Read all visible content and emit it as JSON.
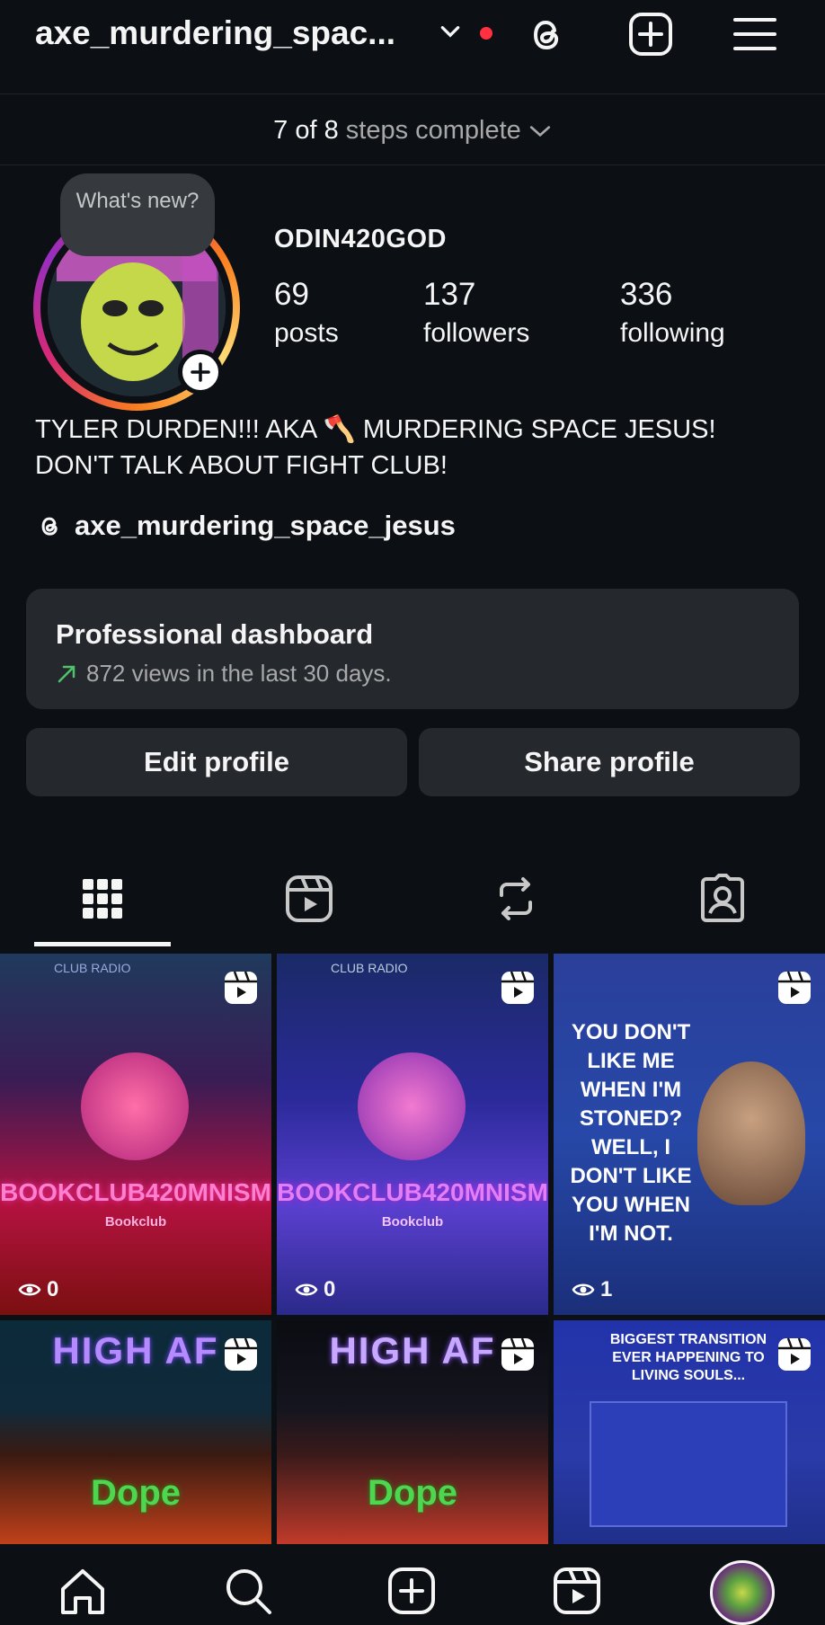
{
  "header": {
    "username": "axe_murdering_spac...",
    "icons": [
      "chevron-down-icon",
      "threads-icon",
      "create-icon",
      "menu-icon"
    ],
    "notification_dot_color": "#ff3040"
  },
  "steps": {
    "done": "7",
    "of": "of",
    "total": "8",
    "text": "steps complete"
  },
  "profile": {
    "bubble_text": "What's new?",
    "display_name": "ODIN420GOD",
    "stats": [
      {
        "number": "69",
        "label": "posts"
      },
      {
        "number": "137",
        "label": "followers"
      },
      {
        "number": "336",
        "label": "following"
      }
    ],
    "bio_line1": "TYLER DURDEN!!! AKA 🪓 MURDERING SPACE JESUS!",
    "bio_line2": "DON'T TALK ABOUT FIGHT CLUB!",
    "threads_handle": "axe_murdering_space_jesus"
  },
  "dashboard": {
    "title": "Professional dashboard",
    "subtitle": "872 views in the last 30 days.",
    "trend_color": "#4fc36b"
  },
  "buttons": {
    "edit": "Edit profile",
    "share": "Share profile"
  },
  "tabs": [
    "grid-icon",
    "reels-icon",
    "reposts-icon",
    "tagged-icon"
  ],
  "grid": [
    {
      "caption": "BOOKCLUB420MNISM",
      "sub": "Bookclub",
      "views": "0",
      "top_text": "CLUB RADIO"
    },
    {
      "caption": "BOOKCLUB420MNISM",
      "sub": "Bookclub",
      "views": "0",
      "top_text": "CLUB RADIO"
    },
    {
      "caption": "YOU DON'T LIKE ME WHEN I'M STONED? WELL, I DON'T LIKE YOU WHEN I'M NOT.",
      "views": "1"
    },
    {
      "caption": "HIGH AF",
      "sub": "Dope"
    },
    {
      "caption": "HIGH AF",
      "sub": "Dope"
    },
    {
      "caption": "BIGGEST TRANSITION EVER HAPPENING TO LIVING SOULS..."
    }
  ],
  "bottom_nav": [
    "home-icon",
    "search-icon",
    "create-icon",
    "reels-icon",
    "profile-avatar"
  ]
}
